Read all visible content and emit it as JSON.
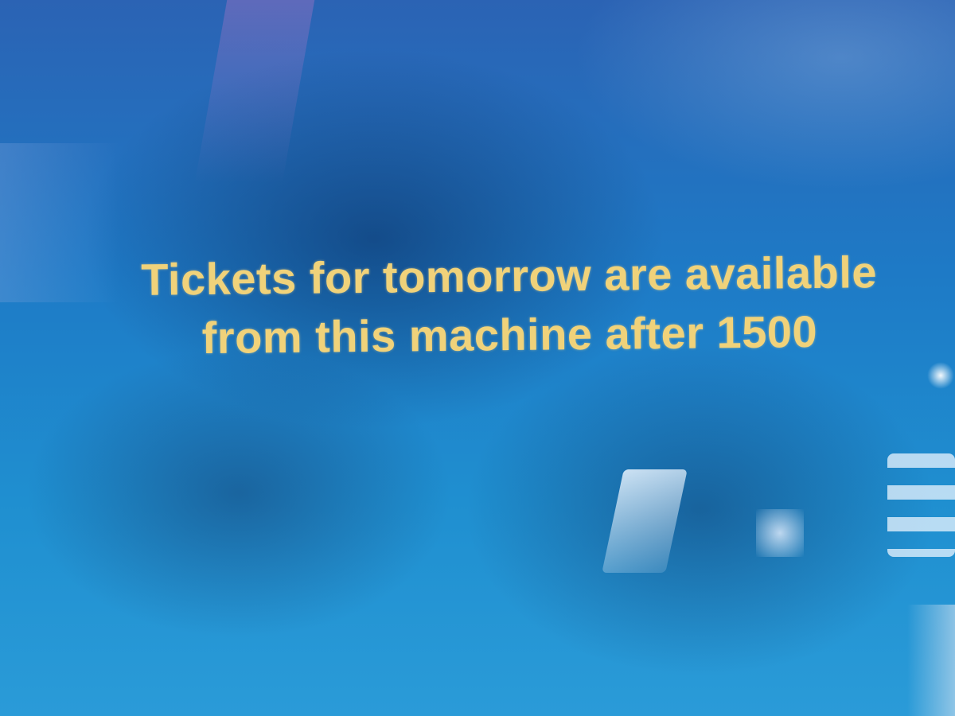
{
  "screen": {
    "background_color": "#1e7ac6",
    "text_color": "#f0d27a"
  },
  "message": {
    "line1": "Tickets for tomorrow are available",
    "line2": "from this machine after 1500"
  }
}
